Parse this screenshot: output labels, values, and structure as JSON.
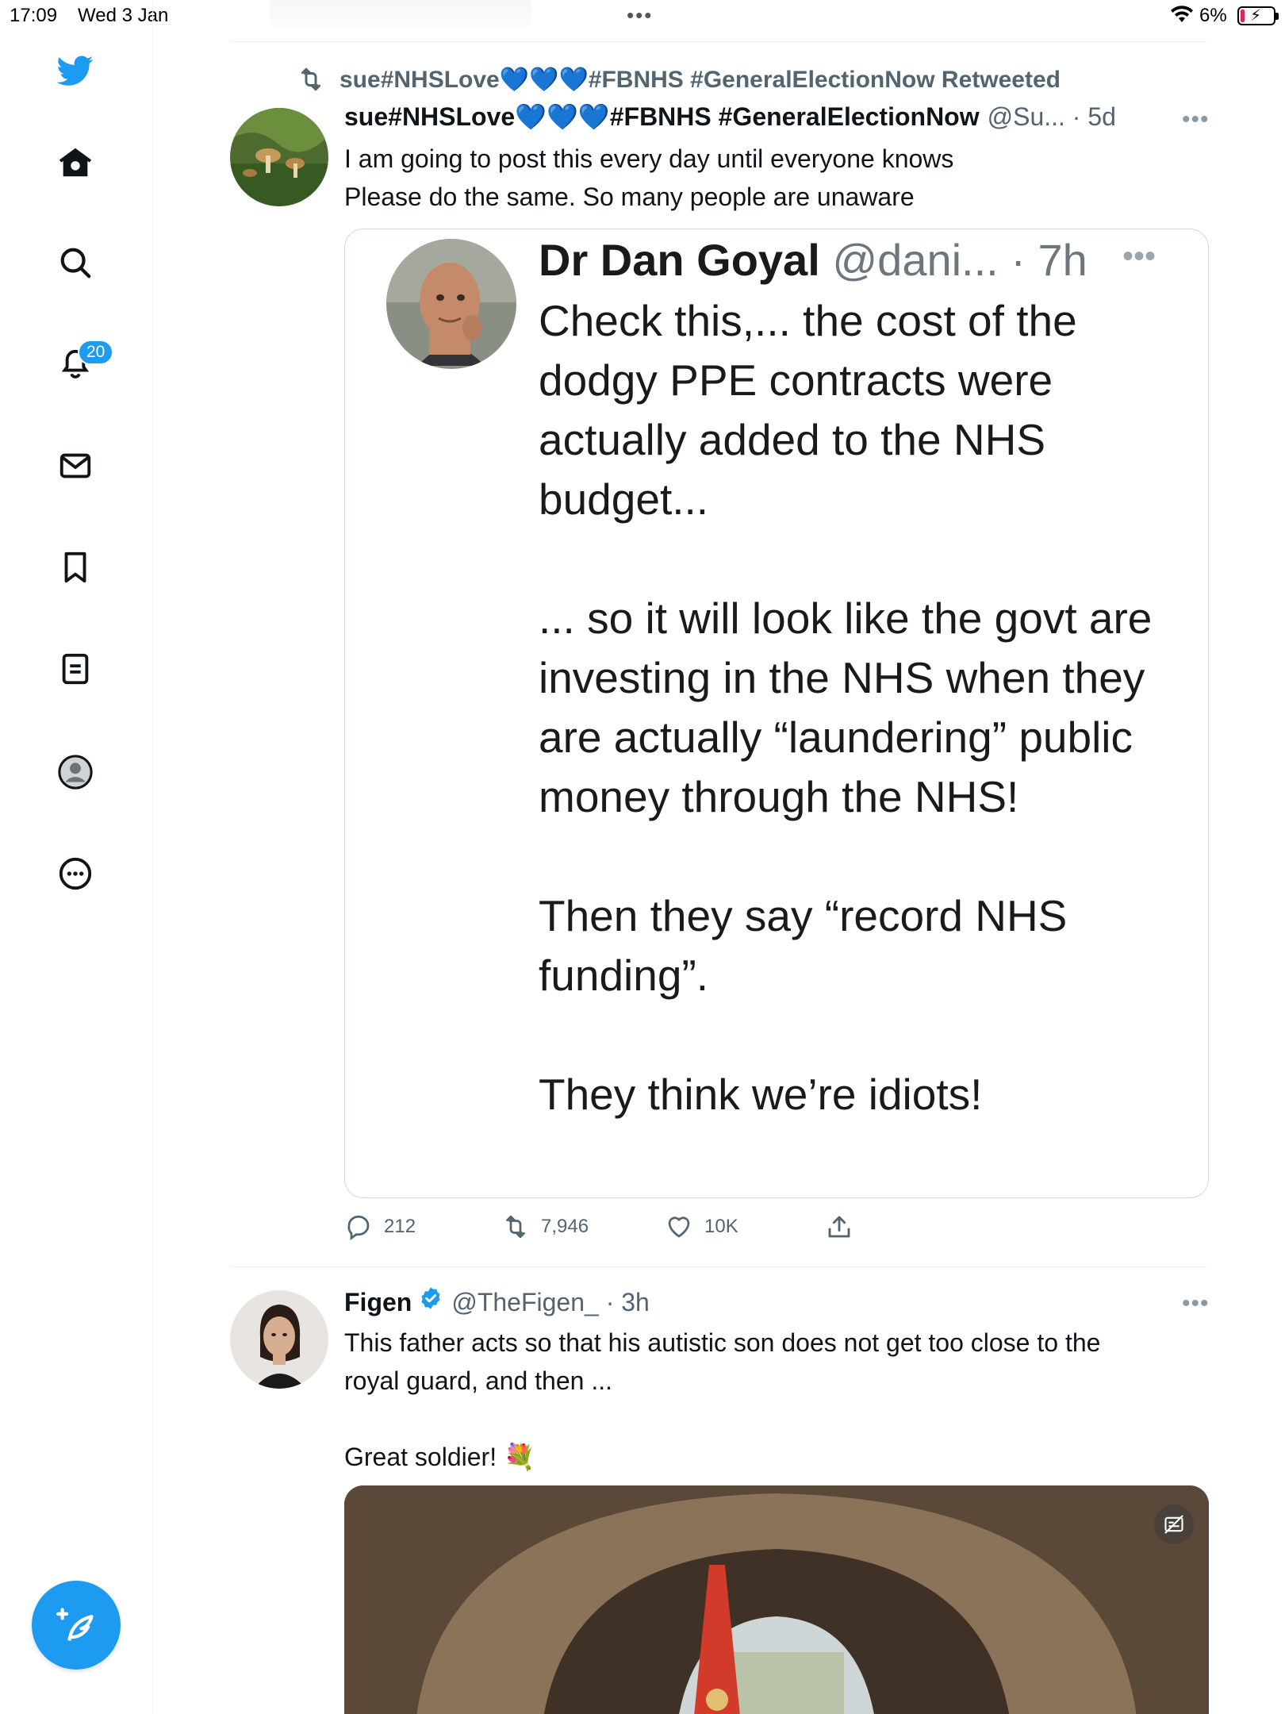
{
  "status_bar": {
    "time": "17:09",
    "date": "Wed 3 Jan",
    "battery_percent": "6%",
    "battery_level": 0.06,
    "battery_color": "#e0245e"
  },
  "sidebar": {
    "items": [
      {
        "name": "home",
        "icon": "home-icon"
      },
      {
        "name": "explore",
        "icon": "search-icon"
      },
      {
        "name": "notifications",
        "icon": "bell-icon",
        "badge": "20"
      },
      {
        "name": "messages",
        "icon": "envelope-icon"
      },
      {
        "name": "bookmarks",
        "icon": "bookmark-icon"
      },
      {
        "name": "lists",
        "icon": "list-icon"
      },
      {
        "name": "profile",
        "icon": "profile-avatar-icon"
      },
      {
        "name": "more",
        "icon": "more-circle-icon"
      }
    ],
    "compose_icon": "compose-feather-icon",
    "accent_color": "#1d9bf0"
  },
  "tweets": [
    {
      "retweet_label": "sue#NHSLove💙💙💙#FBNHS #GeneralElectionNow Retweeted",
      "author_name": "sue#NHSLove💙💙💙#FBNHS #GeneralElectionNow",
      "handle_time": "@Su... · 5d",
      "text": "I am going to post this every day until everyone knows\nPlease do the same. So many people are unaware",
      "quote": {
        "author_name": "Dr Dan Goyal",
        "handle_time": " @dani... · 7h",
        "text": "Check this,... the cost of the dodgy PPE contracts were actually added to the NHS budget...\n\n... so it will look like the govt are investing in the NHS when they are actually “laundering” public money through the NHS!\n\nThen they say “record NHS funding”.\n\nThey think we’re idiots!"
      },
      "replies": "212",
      "retweets": "7,946",
      "likes": "10K"
    },
    {
      "author_name": "Figen",
      "handle_time": "@TheFigen_ · 3h",
      "text": "This father acts so that his autistic son does not get too close to the\nroyal guard, and then ...\n\nGreat soldier! 💐"
    }
  ]
}
